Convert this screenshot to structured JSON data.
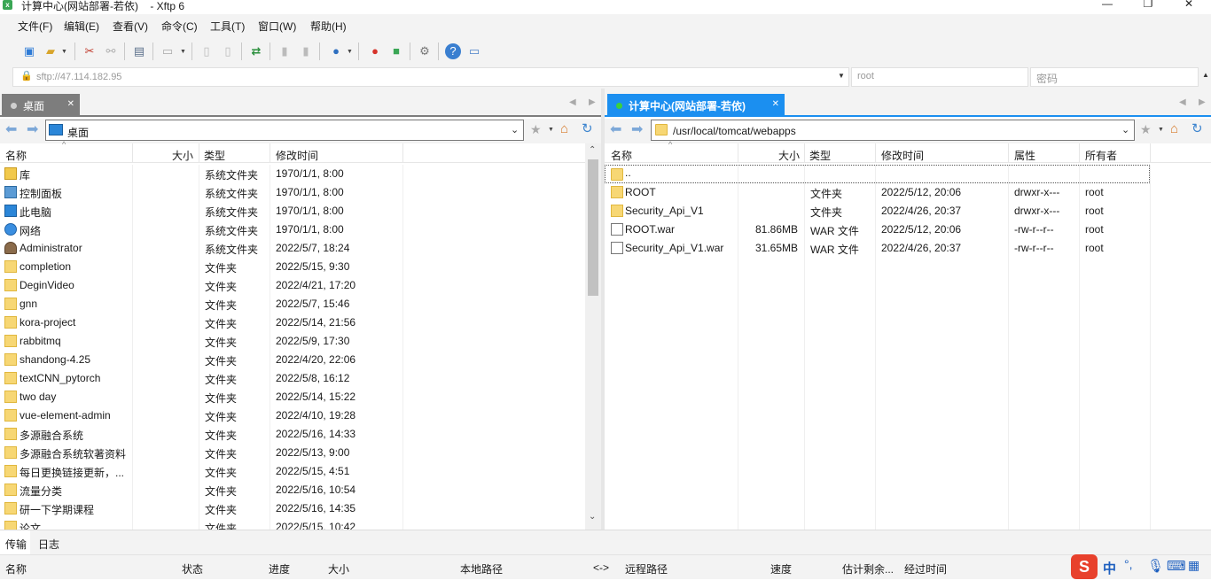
{
  "window": {
    "title": "计算中心(网站部署-若依)    - Xftp 6",
    "app_icon": "xftp-icon"
  },
  "menu": [
    "文件(F)",
    "编辑(E)",
    "查看(V)",
    "命令(C)",
    "工具(T)",
    "窗口(W)",
    "帮助(H)"
  ],
  "address": {
    "url": "sftp://47.114.182.95",
    "user_placeholder": "root",
    "password_placeholder": "密码"
  },
  "left": {
    "tab_label": "桌面",
    "path": "桌面",
    "columns": [
      "名称",
      "大小",
      "类型",
      "修改时间"
    ],
    "rows": [
      {
        "name": "库",
        "size": "",
        "type": "系统文件夹",
        "mtime": "1970/1/1, 8:00",
        "icon": "library-icon"
      },
      {
        "name": "控制面板",
        "size": "",
        "type": "系统文件夹",
        "mtime": "1970/1/1, 8:00",
        "icon": "control-panel-icon"
      },
      {
        "name": "此电脑",
        "size": "",
        "type": "系统文件夹",
        "mtime": "1970/1/1, 8:00",
        "icon": "computer-icon"
      },
      {
        "name": "网络",
        "size": "",
        "type": "系统文件夹",
        "mtime": "1970/1/1, 8:00",
        "icon": "network-icon"
      },
      {
        "name": "Administrator",
        "size": "",
        "type": "系统文件夹",
        "mtime": "2022/5/7, 18:24",
        "icon": "user-icon"
      },
      {
        "name": "completion",
        "size": "",
        "type": "文件夹",
        "mtime": "2022/5/15, 9:30",
        "icon": "folder-icon"
      },
      {
        "name": "DeginVideo",
        "size": "",
        "type": "文件夹",
        "mtime": "2022/4/21, 17:20",
        "icon": "folder-icon"
      },
      {
        "name": "gnn",
        "size": "",
        "type": "文件夹",
        "mtime": "2022/5/7, 15:46",
        "icon": "folder-icon"
      },
      {
        "name": "kora-project",
        "size": "",
        "type": "文件夹",
        "mtime": "2022/5/14, 21:56",
        "icon": "folder-icon"
      },
      {
        "name": "rabbitmq",
        "size": "",
        "type": "文件夹",
        "mtime": "2022/5/9, 17:30",
        "icon": "folder-icon"
      },
      {
        "name": "shandong-4.25",
        "size": "",
        "type": "文件夹",
        "mtime": "2022/4/20, 22:06",
        "icon": "folder-icon"
      },
      {
        "name": "textCNN_pytorch",
        "size": "",
        "type": "文件夹",
        "mtime": "2022/5/8, 16:12",
        "icon": "folder-icon"
      },
      {
        "name": "two day",
        "size": "",
        "type": "文件夹",
        "mtime": "2022/5/14, 15:22",
        "icon": "folder-icon"
      },
      {
        "name": "vue-element-admin",
        "size": "",
        "type": "文件夹",
        "mtime": "2022/4/10, 19:28",
        "icon": "folder-icon"
      },
      {
        "name": "多源融合系统",
        "size": "",
        "type": "文件夹",
        "mtime": "2022/5/16, 14:33",
        "icon": "folder-icon"
      },
      {
        "name": "多源融合系统软著资料",
        "size": "",
        "type": "文件夹",
        "mtime": "2022/5/13, 9:00",
        "icon": "folder-icon"
      },
      {
        "name": "每日更换链接更新，...",
        "size": "",
        "type": "文件夹",
        "mtime": "2022/5/15, 4:51",
        "icon": "folder-icon"
      },
      {
        "name": "流量分类",
        "size": "",
        "type": "文件夹",
        "mtime": "2022/5/16, 10:54",
        "icon": "folder-icon"
      },
      {
        "name": "研一下学期课程",
        "size": "",
        "type": "文件夹",
        "mtime": "2022/5/16, 14:35",
        "icon": "folder-icon"
      },
      {
        "name": "论文",
        "size": "",
        "type": "文件夹",
        "mtime": "2022/5/15, 10:42",
        "icon": "folder-icon"
      }
    ]
  },
  "right": {
    "tab_label": "计算中心(网站部署-若依)",
    "tab_color": "#1b8ff0",
    "status_dot_color": "#3cd13c",
    "path": "/usr/local/tomcat/webapps",
    "columns": [
      "名称",
      "大小",
      "类型",
      "修改时间",
      "属性",
      "所有者"
    ],
    "parent_label": "..",
    "rows": [
      {
        "name": "ROOT",
        "size": "",
        "type": "文件夹",
        "mtime": "2022/5/12, 20:06",
        "perm": "drwxr-x---",
        "owner": "root",
        "icon": "folder-icon"
      },
      {
        "name": "Security_Api_V1",
        "size": "",
        "type": "文件夹",
        "mtime": "2022/4/26, 20:37",
        "perm": "drwxr-x---",
        "owner": "root",
        "icon": "folder-icon"
      },
      {
        "name": "ROOT.war",
        "size": "81.86MB",
        "type": "WAR 文件",
        "mtime": "2022/5/12, 20:06",
        "perm": "-rw-r--r--",
        "owner": "root",
        "icon": "file-icon"
      },
      {
        "name": "Security_Api_V1.war",
        "size": "31.65MB",
        "type": "WAR 文件",
        "mtime": "2022/4/26, 20:37",
        "perm": "-rw-r--r--",
        "owner": "root",
        "icon": "file-icon"
      }
    ]
  },
  "bottom": {
    "tabs": [
      "传输",
      "日志"
    ],
    "columns": [
      "名称",
      "状态",
      "进度",
      "大小",
      "本地路径",
      "<->",
      "远程路径",
      "速度",
      "估计剩余...",
      "经过时间"
    ]
  },
  "ime": {
    "lang": "中",
    "punct": "°,"
  }
}
